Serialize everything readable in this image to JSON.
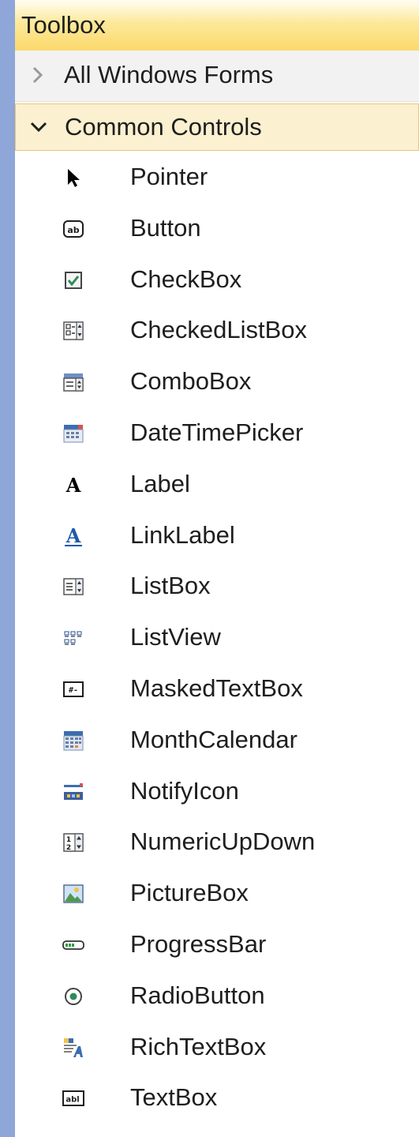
{
  "panel": {
    "title": "Toolbox"
  },
  "categories": [
    {
      "label": "All Windows Forms",
      "state": "collapsed",
      "icon": "chevron-right-icon"
    },
    {
      "label": "Common Controls",
      "state": "expanded",
      "icon": "chevron-down-icon"
    }
  ],
  "items": [
    {
      "label": "Pointer",
      "icon": "pointer-icon"
    },
    {
      "label": "Button",
      "icon": "button-icon"
    },
    {
      "label": "CheckBox",
      "icon": "checkbox-icon"
    },
    {
      "label": "CheckedListBox",
      "icon": "checked-list-box-icon"
    },
    {
      "label": "ComboBox",
      "icon": "combo-box-icon"
    },
    {
      "label": "DateTimePicker",
      "icon": "date-time-picker-icon"
    },
    {
      "label": "Label",
      "icon": "label-icon"
    },
    {
      "label": "LinkLabel",
      "icon": "link-label-icon"
    },
    {
      "label": "ListBox",
      "icon": "list-box-icon"
    },
    {
      "label": "ListView",
      "icon": "list-view-icon"
    },
    {
      "label": "MaskedTextBox",
      "icon": "masked-text-box-icon"
    },
    {
      "label": "MonthCalendar",
      "icon": "month-calendar-icon"
    },
    {
      "label": "NotifyIcon",
      "icon": "notify-icon-icon"
    },
    {
      "label": "NumericUpDown",
      "icon": "numeric-up-down-icon"
    },
    {
      "label": "PictureBox",
      "icon": "picture-box-icon"
    },
    {
      "label": "ProgressBar",
      "icon": "progress-bar-icon"
    },
    {
      "label": "RadioButton",
      "icon": "radio-button-icon"
    },
    {
      "label": "RichTextBox",
      "icon": "rich-text-box-icon"
    },
    {
      "label": "TextBox",
      "icon": "text-box-icon"
    }
  ],
  "icon_glyphs": {
    "button": "ab",
    "label": "A",
    "link_label": "A",
    "masked_text_box": "#-",
    "numeric_up_down_top": "1",
    "numeric_up_down_bottom": "2",
    "text_box": "abl"
  },
  "colors": {
    "title_bar_gradient": "#fbd86b",
    "selected_category_bg": "#fbf0cf",
    "selected_category_border": "#e8c77a",
    "frame_outer": "#8ea6d8",
    "text": "#1e1e1e"
  }
}
